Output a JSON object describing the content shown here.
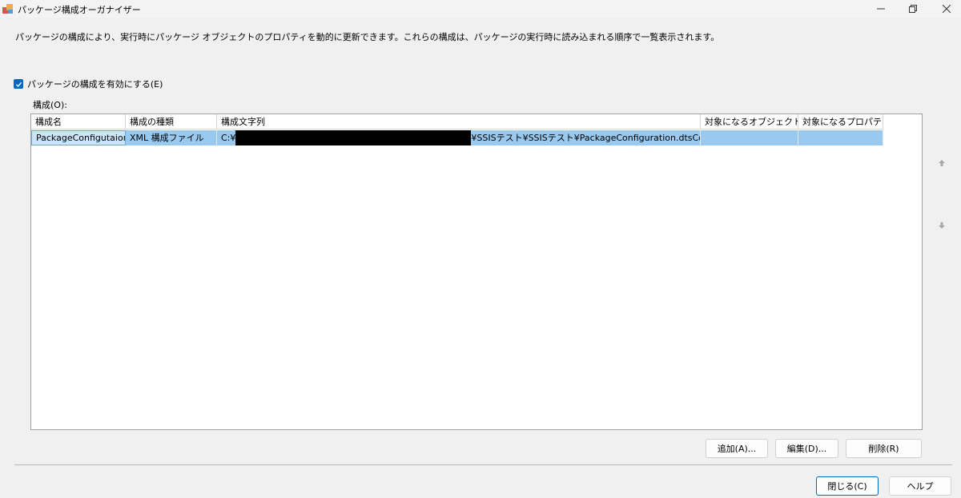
{
  "window": {
    "title": "パッケージ構成オーガナイザー",
    "icon": "ssis-package-icon"
  },
  "description": "パッケージの構成により、実行時にパッケージ オブジェクトのプロパティを動的に更新できます。これらの構成は、パッケージの実行時に読み込まれる順序で一覧表示されます。",
  "enable_configs": {
    "label": "パッケージの構成を有効にする(E)",
    "checked": true
  },
  "configurations": {
    "label": "構成(O):",
    "columns": [
      "構成名",
      "構成の種類",
      "構成文字列",
      "対象になるオブジェクト",
      "対象になるプロパティ"
    ],
    "rows": [
      {
        "name": "PackageConfigutaion",
        "type": "XML 構成ファイル",
        "string_prefix": "C:¥",
        "string_suffix": "¥SSISテスト¥SSISテスト¥PackageConfiguration.dtsConfig",
        "target_object": "",
        "target_property": "",
        "selected": true
      }
    ]
  },
  "buttons": {
    "add": "追加(A)...",
    "edit": "編集(D)...",
    "delete": "削除(R)",
    "close": "閉じる(C)",
    "help": "ヘルプ"
  },
  "colors": {
    "accent": "#0067c0",
    "selection": "#99c9ef"
  }
}
